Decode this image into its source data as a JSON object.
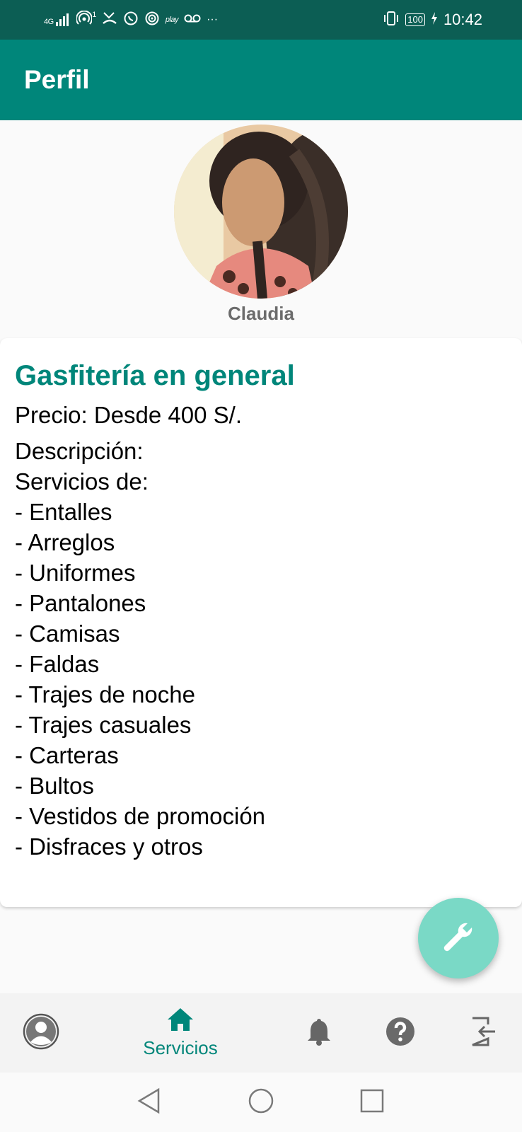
{
  "status_bar": {
    "left_icons": [
      "4G-signal-icon",
      "hotspot-icon",
      "missed-call-icon",
      "whatsapp-icon",
      "hotspot-icon",
      "play-icon",
      "voicemail-icon",
      "more-icon"
    ],
    "network": "4G",
    "hotspot_count": "1",
    "play_label": "play",
    "more": "···",
    "battery": "100",
    "time": "10:42"
  },
  "app_bar": {
    "title": "Perfil"
  },
  "profile": {
    "name": "Claudia"
  },
  "card": {
    "title": "Gasfitería en general",
    "price": "Precio: Desde 400 S/.",
    "description": "Descripción:\nServicios de:\n- Entalles\n- Arreglos\n- Uniformes\n- Pantalones\n- Camisas\n- Faldas\n- Trajes de noche\n- Trajes casuales\n- Carteras\n- Bultos\n- Vestidos de promoción\n- Disfraces y otros"
  },
  "fab": {
    "icon": "wrench-icon"
  },
  "bottom_nav": {
    "items": [
      {
        "icon": "profile-icon",
        "label": ""
      },
      {
        "icon": "home-icon",
        "label": "Servicios",
        "active": true
      },
      {
        "icon": "bell-icon",
        "label": ""
      },
      {
        "icon": "help-icon",
        "label": ""
      },
      {
        "icon": "logout-icon",
        "label": ""
      }
    ]
  },
  "system_nav": {
    "icons": [
      "back-icon",
      "home-circle-icon",
      "recents-icon"
    ]
  },
  "colors": {
    "status_bar": "#0c5e54",
    "primary": "#00867a",
    "fab": "#7ad9c6",
    "text": "#000000",
    "name": "#6b6b6b"
  }
}
